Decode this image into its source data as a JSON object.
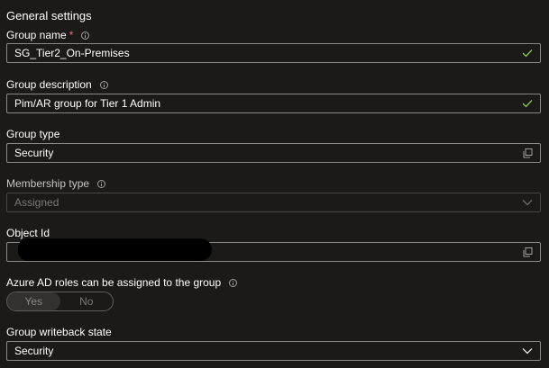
{
  "section_title": "General settings",
  "group_name": {
    "label": "Group name",
    "required_mark": "*",
    "value": "SG_Tier2_On-Premises"
  },
  "group_description": {
    "label": "Group description",
    "value": "Pim/AR group for Tier 1 Admin"
  },
  "group_type": {
    "label": "Group type",
    "value": "Security"
  },
  "membership_type": {
    "label": "Membership type",
    "value": "Assigned"
  },
  "object_id": {
    "label": "Object Id",
    "value": ""
  },
  "azure_ad_roles": {
    "label": "Azure AD roles can be assigned to the group",
    "options": [
      "Yes",
      "No"
    ],
    "selected": "Yes"
  },
  "writeback_state": {
    "label": "Group writeback state",
    "value": "Security"
  },
  "colors": {
    "background": "#1b1a19",
    "border": "#8a8886",
    "check_green": "#92c353",
    "required_red": "#f1707b",
    "disabled_text": "#797775"
  },
  "icons": {
    "info": "info-icon",
    "valid": "checkmark-icon",
    "copy": "copy-icon",
    "dropdown": "chevron-down-icon"
  }
}
